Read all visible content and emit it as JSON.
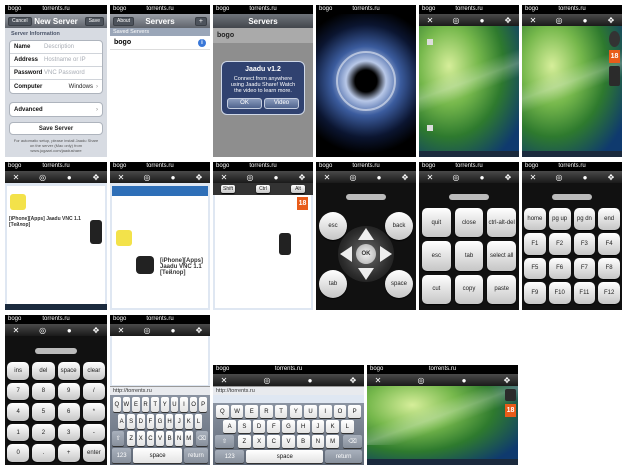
{
  "status": {
    "carrier": "bogo",
    "site": "torrents.ru"
  },
  "new_server": {
    "title": "New Server",
    "cancel": "Cancel",
    "save": "Save",
    "section": "Server Information",
    "fields": [
      {
        "label": "Name",
        "placeholder": "Description"
      },
      {
        "label": "Address",
        "placeholder": "Hostname or IP"
      },
      {
        "label": "Password",
        "placeholder": "VNC Password"
      },
      {
        "label": "Computer",
        "value": "Windows"
      }
    ],
    "advanced": "Advanced",
    "save_server": "Save Server",
    "footer": "For automatic setup, please install Jaadu Share on the server (Mac only) from www.jugaari.com/jaadushare"
  },
  "servers": {
    "title": "Servers",
    "about": "About",
    "add": "+",
    "section": "Saved Servers",
    "item": "bogo"
  },
  "alert": {
    "title": "Jaadu v1.2",
    "message": "Connect from anywhere using Jaadu Share! Watch the video to learn more.",
    "ok": "OK",
    "video": "Video",
    "list_item": "bogo"
  },
  "toolbar_icons": [
    "close-icon",
    "target-icon",
    "light-icon",
    "move-icon"
  ],
  "keypad_nav": {
    "esc": "esc",
    "back": "back",
    "tab": "tab",
    "space": "space",
    "ok": "OK"
  },
  "keypad_edit": [
    "quit",
    "close",
    "ctrl-alt-del",
    "esc",
    "tab",
    "select all",
    "cut",
    "copy",
    "paste"
  ],
  "keypad_fn": [
    "home",
    "pg up",
    "pg dn",
    "end",
    "F1",
    "F2",
    "F3",
    "F4",
    "F5",
    "F6",
    "F7",
    "F8",
    "F9",
    "F10",
    "F11",
    "F12"
  ],
  "keypad_num": [
    "ins",
    "del",
    "space",
    "clear",
    "7",
    "8",
    "9",
    "/",
    "4",
    "5",
    "6",
    "*",
    "1",
    "2",
    "3",
    "-",
    "0",
    ".",
    "+",
    "enter"
  ],
  "modifiers": [
    "Shift",
    "Ctrl",
    "Alt"
  ],
  "browser": {
    "url": "http://torrents.ru",
    "article_title": "[iPhone][Apps] Jaadu VNC 1.1 [Тейлор]",
    "badge": "18"
  },
  "keyboard": {
    "row1": [
      "Q",
      "W",
      "E",
      "R",
      "T",
      "Y",
      "U",
      "I",
      "O",
      "P"
    ],
    "row2": [
      "A",
      "S",
      "D",
      "F",
      "G",
      "H",
      "J",
      "K",
      "L"
    ],
    "row3": [
      "Z",
      "X",
      "C",
      "V",
      "B",
      "N",
      "M"
    ],
    "numbers": "123",
    "space": "space",
    "return": "return"
  },
  "colors": {
    "accent": "#e85c1a",
    "nav": "#6b7079",
    "alert": "#283c6e"
  }
}
